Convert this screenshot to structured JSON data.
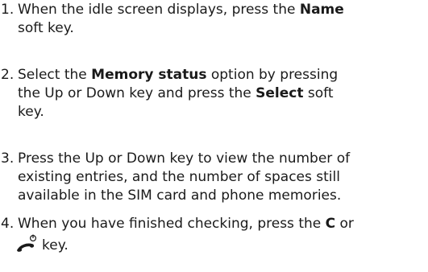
{
  "steps": [
    {
      "number": "1.",
      "line1": "When the idle screen displays, press the ",
      "bold1": "Name",
      "line2": "soft key."
    },
    {
      "number": "2.",
      "text1": "Select the ",
      "bold1": "Memory status",
      "text2": " option by pressing",
      "text3": "the Up or Down key and press the ",
      "bold2": "Select",
      "text4": " soft",
      "text5": "key."
    },
    {
      "number": "3.",
      "line1": "Press the Up or Down key to view the number of",
      "line2": "existing entries, and the number of spaces still",
      "line3": "available in the SIM card and phone memories."
    },
    {
      "number": "4.",
      "text1": "When you have finished checking, press the ",
      "bold1": "C",
      "text2": " or",
      "text3": "key.",
      "icon": "end-call-power-key-icon"
    }
  ]
}
